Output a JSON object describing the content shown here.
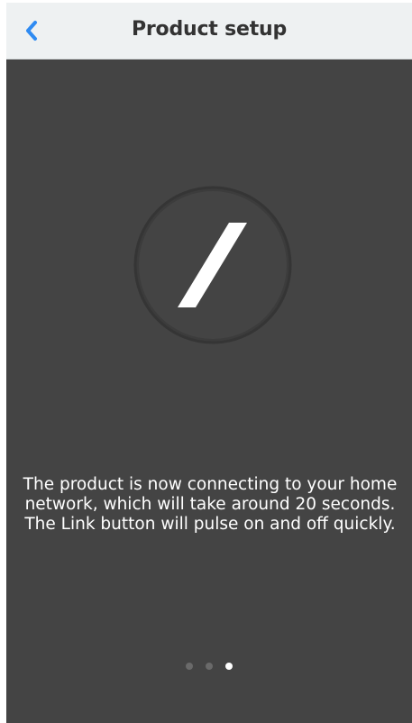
{
  "header": {
    "title": "Product setup",
    "back_icon": "chevron-left-icon",
    "accent_color": "#2f8bf2"
  },
  "main": {
    "status_icon": "connecting-slash-icon",
    "message": "The product is now connecting to your home network, which will take around 20 seconds. The Link button will pulse on and off quickly."
  },
  "pager": {
    "total": 3,
    "current": 3
  }
}
